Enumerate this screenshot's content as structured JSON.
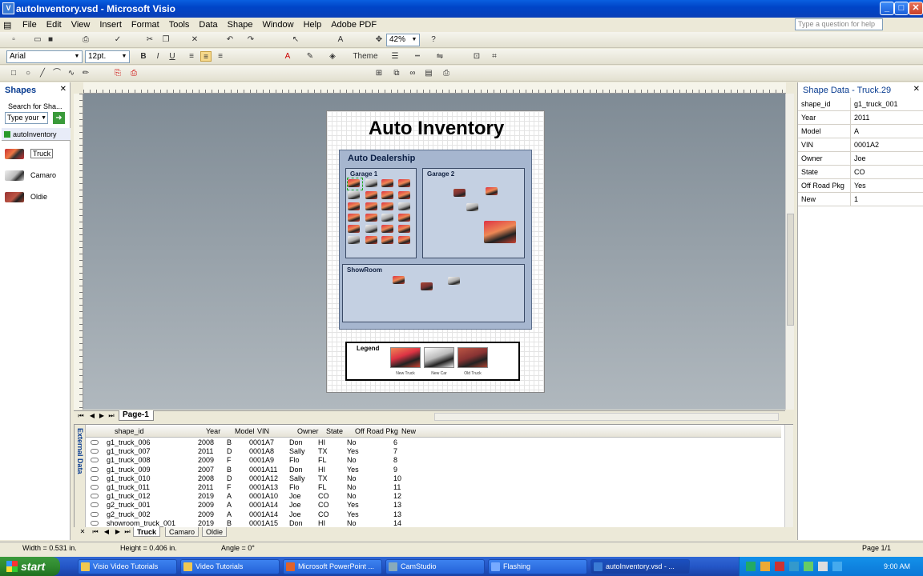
{
  "window": {
    "title": "autoInventory.vsd - Microsoft Visio",
    "help_placeholder": "Type a question for help"
  },
  "menu": [
    "File",
    "Edit",
    "View",
    "Insert",
    "Format",
    "Tools",
    "Data",
    "Shape",
    "Window",
    "Help",
    "Adobe PDF"
  ],
  "toolbar": {
    "zoom": "42%",
    "font": "Arial",
    "size": "12pt.",
    "theme": "Theme"
  },
  "shapes_panel": {
    "title": "Shapes",
    "search_label": "Search for Sha...",
    "search_placeholder": "Type your",
    "stencil": "autoInventory",
    "items": [
      "Truck",
      "Camaro",
      "Oldie"
    ]
  },
  "drawing": {
    "title": "Auto Inventory",
    "dealership": "Auto Dealership",
    "garage1": "Garage 1",
    "garage2": "Garage 2",
    "showroom": "ShowRoom",
    "legend": "Legend",
    "legend_items": [
      "New Truck",
      "New Car",
      "Old Truck"
    ]
  },
  "page_tab": "Page-1",
  "shape_data": {
    "title": "Shape Data - Truck.29",
    "rows": [
      {
        "k": "shape_id",
        "v": "g1_truck_001"
      },
      {
        "k": "Year",
        "v": "2011"
      },
      {
        "k": "Model",
        "v": "A"
      },
      {
        "k": "VIN",
        "v": "0001A2"
      },
      {
        "k": "Owner",
        "v": "Joe"
      },
      {
        "k": "State",
        "v": "CO"
      },
      {
        "k": "Off Road Pkg",
        "v": "Yes"
      },
      {
        "k": "New",
        "v": "1"
      }
    ]
  },
  "external_data": {
    "label": "External Data",
    "columns": [
      "shape_id",
      "Year",
      "Model",
      "VIN",
      "Owner",
      "State",
      "Off Road Pkg",
      "New"
    ],
    "rows": [
      [
        "g1_truck_006",
        "2008",
        "B",
        "0001A7",
        "Don",
        "HI",
        "No",
        "6"
      ],
      [
        "g1_truck_007",
        "2011",
        "D",
        "0001A8",
        "Sally",
        "TX",
        "Yes",
        "7"
      ],
      [
        "g1_truck_008",
        "2009",
        "F",
        "0001A9",
        "Flo",
        "FL",
        "No",
        "8"
      ],
      [
        "g1_truck_009",
        "2007",
        "B",
        "0001A11",
        "Don",
        "HI",
        "Yes",
        "9"
      ],
      [
        "g1_truck_010",
        "2008",
        "D",
        "0001A12",
        "Sally",
        "TX",
        "No",
        "10"
      ],
      [
        "g1_truck_011",
        "2011",
        "F",
        "0001A13",
        "Flo",
        "FL",
        "No",
        "11"
      ],
      [
        "g1_truck_012",
        "2019",
        "A",
        "0001A10",
        "Joe",
        "CO",
        "No",
        "12"
      ],
      [
        "g2_truck_001",
        "2009",
        "A",
        "0001A14",
        "Joe",
        "CO",
        "Yes",
        "13"
      ],
      [
        "g2_truck_002",
        "2009",
        "A",
        "0001A14",
        "Joe",
        "CO",
        "Yes",
        "13"
      ],
      [
        "showroom_truck_001",
        "2019",
        "B",
        "0001A15",
        "Don",
        "HI",
        "No",
        "14"
      ]
    ],
    "tabs": [
      "Truck",
      "Camaro",
      "Oldie"
    ]
  },
  "status": {
    "width": "Width = 0.531 in.",
    "height": "Height = 0.406 in.",
    "angle": "Angle = 0°",
    "page": "Page 1/1"
  },
  "taskbar": {
    "start": "start",
    "tasks": [
      "Visio Video Tutorials",
      "Video Tutorials",
      "Microsoft PowerPoint ...",
      "CamStudio",
      "Flashing",
      "autoInventory.vsd - ..."
    ],
    "clock": "9:00 AM"
  }
}
